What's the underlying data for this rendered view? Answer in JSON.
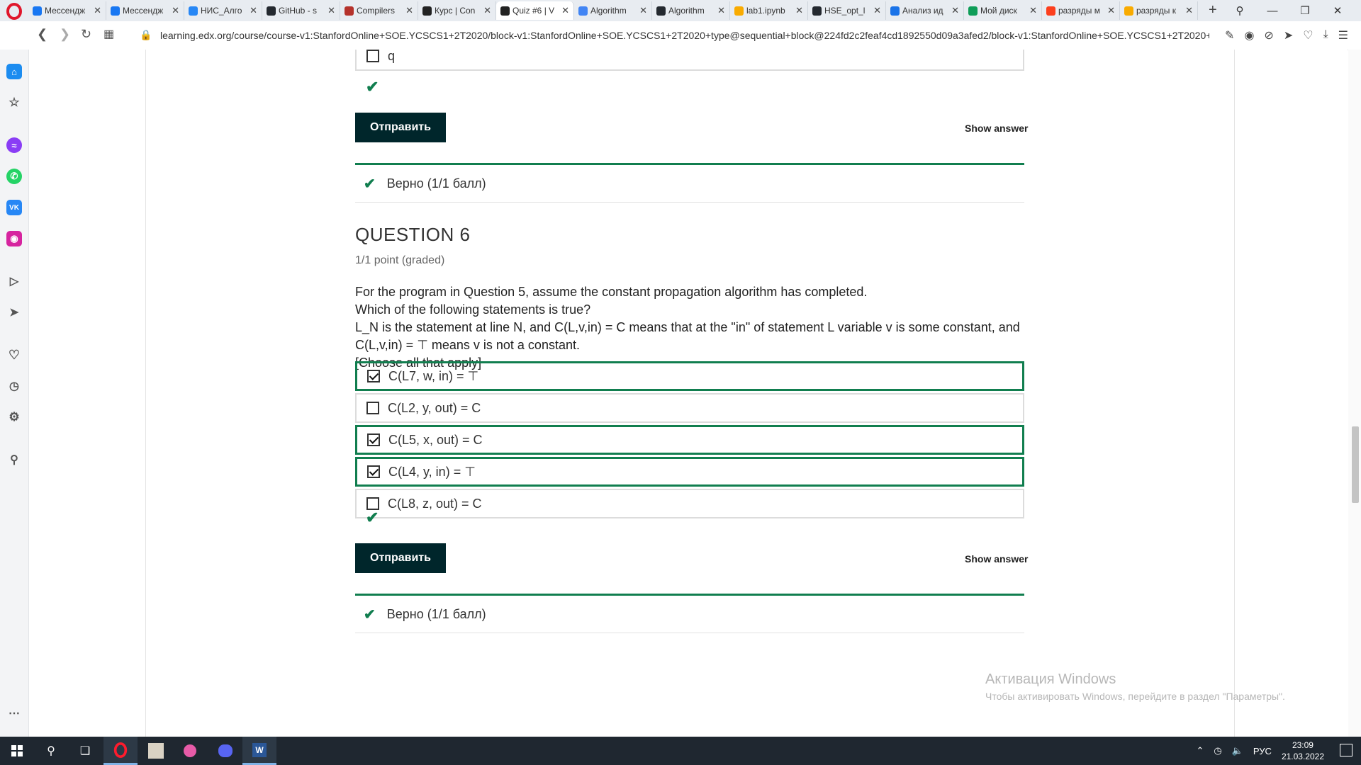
{
  "browser": {
    "tabs": [
      {
        "label": "Мессендж",
        "color": "#1877f2"
      },
      {
        "label": "Мессендж",
        "color": "#1877f2"
      },
      {
        "label": "НИС_Алго",
        "color": "#2787f5"
      },
      {
        "label": "GitHub - s",
        "color": "#24292f"
      },
      {
        "label": "Compilers",
        "color": "#b5322b"
      },
      {
        "label": "Курс | Con",
        "color": "#222222"
      },
      {
        "label": "Quiz #6 | V",
        "color": "#222222",
        "active": true
      },
      {
        "label": "Algorithm",
        "color": "#4285f4"
      },
      {
        "label": "Algorithm",
        "color": "#24292f"
      },
      {
        "label": "lab1.ipynb",
        "color": "#f9ab00"
      },
      {
        "label": "HSE_opt_l",
        "color": "#24292f"
      },
      {
        "label": "Анализ ид",
        "color": "#1a73e8"
      },
      {
        "label": "Мой диск",
        "color": "#0f9d58"
      },
      {
        "label": "разряды м",
        "color": "#fc3f1d"
      },
      {
        "label": "разряды к",
        "color": "#f9ab00"
      }
    ],
    "new_tab": "+",
    "url": "learning.edx.org/course/course-v1:StanfordOnline+SOE.YCSCS1+2T2020/block-v1:StanfordOnline+SOE.YCSCS1+2T2020+type@sequential+block@224fd2c2feaf4cd1892550d09a3afed2/block-v1:StanfordOnline+SOE.YCSCS1+2T2020+type@"
  },
  "prev_question": {
    "choice_label": "q",
    "submit_label": "Отправить",
    "show_answer": "Show answer",
    "result": "Верно (1/1 балл)"
  },
  "question": {
    "title": "QUESTION 6",
    "points": "1/1 point (graded)",
    "text_lines": [
      "For the program in Question 5, assume the constant propagation algorithm has completed.",
      "Which of the following statements is true?",
      "L_N is the statement at line N, and C(L,v,in) = C means that at the \"in\" of statement L variable v is some constant, and C(L,v,in) = ⊤ means v is not a constant.",
      "[Choose all that apply]"
    ],
    "choices": [
      {
        "label": "C(L7, w, in) = ⊤",
        "checked": true
      },
      {
        "label": "C(L2, y, out) = C",
        "checked": false
      },
      {
        "label": "C(L5, x, out) = C",
        "checked": true
      },
      {
        "label": "C(L4, y, in) = ⊤",
        "checked": true
      },
      {
        "label": "C(L8, z, out) = C",
        "checked": false
      }
    ],
    "submit_label": "Отправить",
    "show_answer": "Show answer",
    "result": "Верно (1/1 балл)"
  },
  "activation": {
    "title": "Активация Windows",
    "subtitle": "Чтобы активировать Windows, перейдите в раздел \"Параметры\"."
  },
  "taskbar": {
    "lang": "РУС",
    "time": "23:09",
    "date": "21.03.2022"
  },
  "colors": {
    "correct_green": "#117e4f",
    "submit_bg": "#00262b"
  }
}
